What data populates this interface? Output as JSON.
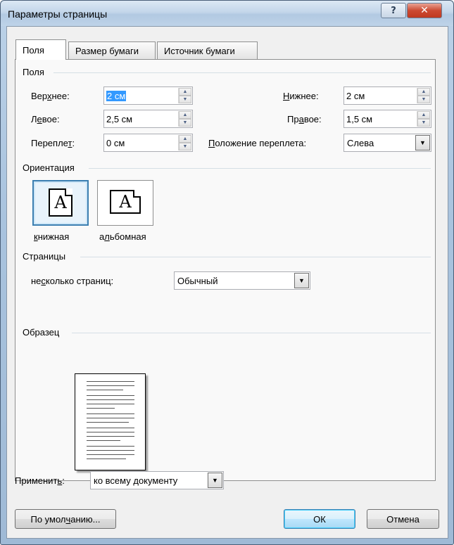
{
  "window": {
    "title": "Параметры страницы",
    "help_glyph": "?",
    "close_glyph": "✕"
  },
  "tabs": [
    {
      "label": "Поля",
      "active": true
    },
    {
      "label": "Размер бумаги",
      "active": false
    },
    {
      "label": "Источник бумаги",
      "active": false
    }
  ],
  "margins": {
    "group_label": "Поля",
    "top": {
      "pre": "Вер",
      "u": "х",
      "post": "нее:",
      "value": "2 см"
    },
    "bottom": {
      "pre": "",
      "u": "Н",
      "post": "ижнее:",
      "value": "2 см"
    },
    "left": {
      "pre": "Л",
      "u": "е",
      "post": "вое:",
      "value": "2,5 см"
    },
    "right": {
      "pre": "Пр",
      "u": "а",
      "post": "вое:",
      "value": "1,5 см"
    },
    "gutter": {
      "pre": "Перепле",
      "u": "т",
      "post": ":",
      "value": "0 см"
    },
    "gutter_position": {
      "pre": "",
      "u": "П",
      "post": "оложение переплета:",
      "value": "Слева"
    }
  },
  "orientation": {
    "group_label": "Ориентация",
    "icon_letter": "A",
    "portrait": {
      "pre": "",
      "u": "к",
      "post": "нижная",
      "selected": true
    },
    "landscape": {
      "pre": "а",
      "u": "л",
      "post": "ьбомная",
      "selected": false
    }
  },
  "pages": {
    "group_label": "Страницы",
    "multiple": {
      "pre": "не",
      "u": "с",
      "post": "колько страниц:",
      "value": "Обычный"
    }
  },
  "preview": {
    "group_label": "Образец"
  },
  "apply": {
    "pre": "Применит",
    "u": "ь",
    "post": ":",
    "value": "ко всему документу"
  },
  "buttons": {
    "default": {
      "pre": "По умол",
      "u": "ч",
      "post": "анию..."
    },
    "ok": "ОК",
    "cancel": "Отмена"
  },
  "colors": {
    "selection": "#3399ff",
    "accent_border": "#3c7fb1"
  }
}
